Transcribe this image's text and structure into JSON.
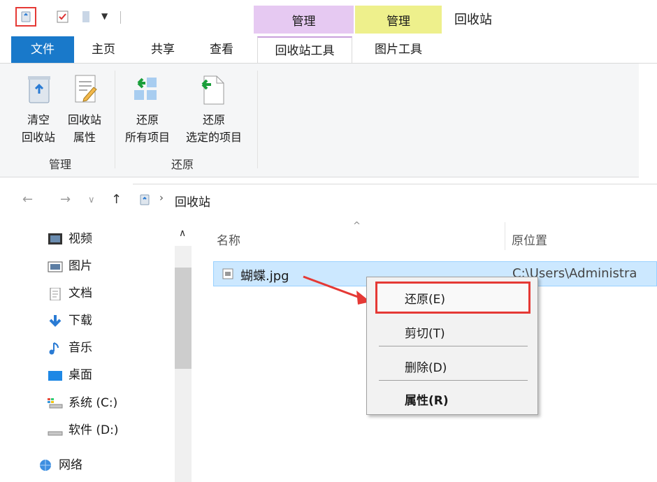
{
  "titlebar": {
    "context_tabs": [
      "管理",
      "管理"
    ],
    "window_title": "回收站"
  },
  "tabs": [
    "文件",
    "主页",
    "共享",
    "查看",
    "回收站工具",
    "图片工具"
  ],
  "ribbon": {
    "empty_bin": [
      "清空",
      "回收站"
    ],
    "bin_properties": [
      "回收站",
      "属性"
    ],
    "restore_all": [
      "还原",
      "所有项目"
    ],
    "restore_selected": [
      "还原",
      "选定的项目"
    ],
    "groups": [
      "管理",
      "还原"
    ]
  },
  "address": {
    "location": "回收站"
  },
  "sidebar": {
    "items": [
      "视频",
      "图片",
      "文档",
      "下载",
      "音乐",
      "桌面",
      "系统 (C:)",
      "软件 (D:)",
      "网络"
    ]
  },
  "file_list": {
    "columns": [
      "名称",
      "原位置"
    ],
    "rows": [
      {
        "name": "蝴蝶.jpg",
        "original_location": "C:\\Users\\Administra"
      }
    ]
  },
  "context_menu": {
    "items": [
      "还原(E)",
      "剪切(T)",
      "删除(D)",
      "属性(R)"
    ]
  },
  "colors": {
    "file_tab": "#1979ca",
    "context_tab_purple": "#e6c9f2",
    "context_tab_yellow": "#eef08c",
    "selection": "#cce8ff",
    "highlight": "#e53935"
  }
}
